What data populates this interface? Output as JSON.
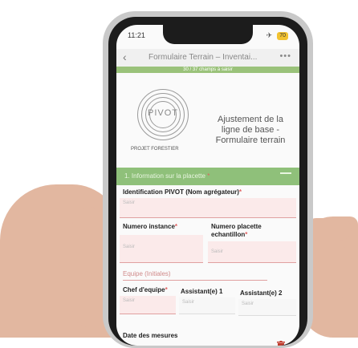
{
  "status_bar": {
    "time": "11:21",
    "battery": "70"
  },
  "nav": {
    "back": "‹",
    "title": "Formulaire Terrain – Inventai...",
    "more": "•••"
  },
  "progress": {
    "text": "30 / 37 champs à saisir"
  },
  "header": {
    "logo_text": "PIVOT",
    "logo_sub": "PROJET FORESTIER",
    "title_lines": [
      "Ajustement de la",
      "ligne de base -",
      "Formulaire terrain"
    ]
  },
  "section1": {
    "label": "1. Information sur la placette",
    "req": "*"
  },
  "fields": {
    "id_pivot_label": "Identification PIVOT (Nom agrégateur)",
    "id_pivot_req": "*",
    "placeholder": "Saisir",
    "numero_instance_label": "Numero instance",
    "numero_instance_req": "*",
    "numero_placette_label": "Numero placette echantillon",
    "numero_placette_req": "*",
    "equipe_label": "Equipe (Initiales)",
    "chef_label": "Chef d'equipe",
    "chef_req": "*",
    "assistant1_label": "Assistant(e) 1",
    "assistant2_label": "Assistant(e) 2",
    "date_label": "Date des mesures"
  },
  "colors": {
    "section_bg": "#8fc07a",
    "accent_red": "#c0392b"
  },
  "icons": {
    "trash": "trash-icon",
    "back": "back-icon",
    "more": "more-icon"
  }
}
